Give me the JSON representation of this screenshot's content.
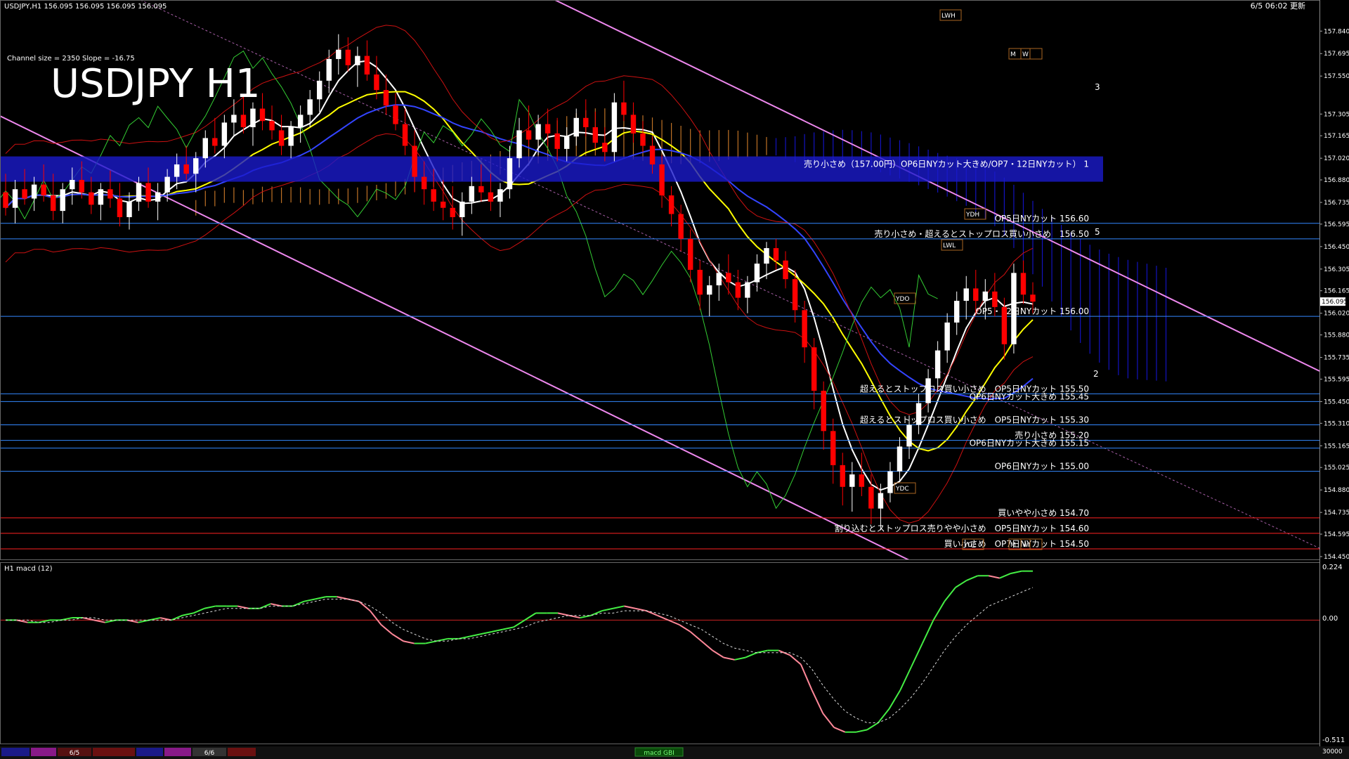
{
  "header": {
    "symbol_info": "USDJPY,H1  156.095 156.095 156.095 156.095",
    "datetime": "6/5 06:02 更新",
    "channel_info": "Channel size = 2350 Slope = -16.75",
    "big_title": "USDJPY H1"
  },
  "macd_panel": {
    "label": "H1  macd (12)",
    "scale_top": "0.224",
    "scale_zero": "0.00",
    "scale_bottom": "-0.511"
  },
  "bottom_bar": {
    "tab_6_5": "6/5",
    "tab_6_6": "6/6",
    "tab_macd": "macd GBI",
    "volume_scale": "30000"
  },
  "colors": {
    "background": "#000000",
    "bull_candle": "#ffffff",
    "bear_candle": "#ff0000",
    "channel_line": "#ee88ee",
    "kumo_blue": "#1a1aff",
    "kumo_orange": "#ff9933",
    "ma_white": "#ffffff",
    "ma_yellow": "#ffff00",
    "ma_blue": "#3344ff",
    "macd_green": "#44ee44",
    "macd_pink": "#ff8899",
    "level_blue": "#3388ff",
    "level_red": "#ff2222"
  },
  "chart_data": {
    "type": "candlestick",
    "price_axis": {
      "ylim": [
        154.45,
        157.95
      ],
      "tick_labels": [
        "157.840",
        "157.695",
        "157.550",
        "157.305",
        "157.165",
        "157.020",
        "156.880",
        "156.735",
        "156.595",
        "156.450",
        "156.305",
        "156.165",
        "156.020",
        "155.880",
        "155.735",
        "155.595",
        "155.450",
        "155.310",
        "155.165",
        "155.025",
        "154.880",
        "154.735",
        "154.595",
        "154.450"
      ],
      "current_price": "156.095"
    },
    "candles": [
      [
        156.8,
        156.92,
        156.65,
        156.7
      ],
      [
        156.7,
        156.88,
        156.6,
        156.82
      ],
      [
        156.82,
        156.95,
        156.72,
        156.76
      ],
      [
        156.76,
        156.9,
        156.68,
        156.85
      ],
      [
        156.85,
        156.98,
        156.74,
        156.78
      ],
      [
        156.78,
        156.92,
        156.62,
        156.68
      ],
      [
        156.68,
        156.86,
        156.6,
        156.82
      ],
      [
        156.82,
        156.96,
        156.72,
        156.88
      ],
      [
        156.88,
        157.0,
        156.76,
        156.8
      ],
      [
        156.8,
        156.9,
        156.66,
        156.72
      ],
      [
        156.72,
        156.86,
        156.62,
        156.82
      ],
      [
        156.82,
        156.94,
        156.7,
        156.76
      ],
      [
        156.76,
        156.86,
        156.58,
        156.64
      ],
      [
        156.64,
        156.8,
        156.56,
        156.74
      ],
      [
        156.74,
        156.9,
        156.68,
        156.86
      ],
      [
        156.86,
        156.96,
        156.7,
        156.74
      ],
      [
        156.74,
        156.86,
        156.62,
        156.8
      ],
      [
        156.8,
        156.95,
        156.74,
        156.9
      ],
      [
        156.9,
        157.05,
        156.82,
        156.98
      ],
      [
        156.98,
        157.1,
        156.88,
        156.92
      ],
      [
        156.92,
        157.06,
        156.8,
        157.02
      ],
      [
        157.02,
        157.2,
        156.96,
        157.15
      ],
      [
        157.15,
        157.28,
        157.05,
        157.1
      ],
      [
        157.1,
        157.3,
        157.02,
        157.25
      ],
      [
        157.25,
        157.4,
        157.16,
        157.3
      ],
      [
        157.3,
        157.42,
        157.18,
        157.22
      ],
      [
        157.22,
        157.38,
        157.1,
        157.34
      ],
      [
        157.34,
        157.44,
        157.2,
        157.26
      ],
      [
        157.26,
        157.36,
        157.14,
        157.2
      ],
      [
        157.2,
        157.3,
        157.04,
        157.1
      ],
      [
        157.1,
        157.26,
        157.02,
        157.22
      ],
      [
        157.22,
        157.36,
        157.12,
        157.3
      ],
      [
        157.3,
        157.46,
        157.22,
        157.4
      ],
      [
        157.4,
        157.58,
        157.32,
        157.52
      ],
      [
        157.52,
        157.72,
        157.44,
        157.66
      ],
      [
        157.66,
        157.82,
        157.56,
        157.72
      ],
      [
        157.72,
        157.8,
        157.58,
        157.62
      ],
      [
        157.62,
        157.74,
        157.48,
        157.68
      ],
      [
        157.68,
        157.78,
        157.52,
        157.56
      ],
      [
        157.56,
        157.68,
        157.4,
        157.46
      ],
      [
        157.46,
        157.56,
        157.3,
        157.36
      ],
      [
        157.36,
        157.44,
        157.2,
        157.24
      ],
      [
        157.24,
        157.34,
        157.04,
        157.1
      ],
      [
        157.1,
        157.2,
        156.8,
        156.9
      ],
      [
        156.9,
        157.0,
        156.72,
        156.82
      ],
      [
        156.82,
        156.95,
        156.68,
        156.74
      ],
      [
        156.74,
        156.88,
        156.62,
        156.7
      ],
      [
        156.7,
        156.84,
        156.56,
        156.64
      ],
      [
        156.64,
        156.8,
        156.52,
        156.74
      ],
      [
        156.74,
        156.9,
        156.66,
        156.84
      ],
      [
        156.84,
        156.98,
        156.74,
        156.8
      ],
      [
        156.8,
        156.92,
        156.68,
        156.74
      ],
      [
        156.74,
        156.86,
        156.64,
        156.82
      ],
      [
        156.82,
        157.1,
        156.76,
        157.02
      ],
      [
        157.02,
        157.28,
        156.96,
        157.2
      ],
      [
        157.2,
        157.36,
        157.1,
        157.14
      ],
      [
        157.14,
        157.3,
        157.04,
        157.24
      ],
      [
        157.24,
        157.34,
        157.1,
        157.18
      ],
      [
        157.18,
        157.28,
        157.0,
        157.08
      ],
      [
        157.08,
        157.22,
        157.0,
        157.16
      ],
      [
        157.16,
        157.34,
        157.1,
        157.28
      ],
      [
        157.28,
        157.4,
        157.16,
        157.22
      ],
      [
        157.22,
        157.32,
        157.08,
        157.12
      ],
      [
        157.12,
        157.22,
        157.0,
        157.06
      ],
      [
        157.06,
        157.44,
        157.0,
        157.38
      ],
      [
        157.38,
        157.52,
        157.26,
        157.3
      ],
      [
        157.3,
        157.38,
        157.12,
        157.18
      ],
      [
        157.18,
        157.26,
        157.06,
        157.1
      ],
      [
        157.1,
        157.16,
        156.92,
        156.98
      ],
      [
        156.98,
        157.04,
        156.7,
        156.78
      ],
      [
        156.78,
        156.84,
        156.58,
        156.66
      ],
      [
        156.66,
        156.72,
        156.42,
        156.5
      ],
      [
        156.5,
        156.56,
        156.22,
        156.3
      ],
      [
        156.3,
        156.36,
        156.04,
        156.14
      ],
      [
        156.14,
        156.26,
        156.0,
        156.2
      ],
      [
        156.2,
        156.34,
        156.1,
        156.28
      ],
      [
        156.28,
        156.4,
        156.14,
        156.22
      ],
      [
        156.22,
        156.3,
        156.04,
        156.12
      ],
      [
        156.12,
        156.26,
        156.02,
        156.22
      ],
      [
        156.22,
        156.4,
        156.16,
        156.34
      ],
      [
        156.34,
        156.48,
        156.24,
        156.44
      ],
      [
        156.44,
        156.5,
        156.3,
        156.36
      ],
      [
        156.36,
        156.42,
        156.18,
        156.24
      ],
      [
        156.24,
        156.3,
        155.96,
        156.04
      ],
      [
        156.04,
        156.1,
        155.7,
        155.8
      ],
      [
        155.8,
        155.86,
        155.4,
        155.52
      ],
      [
        155.52,
        155.58,
        155.14,
        155.26
      ],
      [
        155.26,
        155.34,
        154.92,
        155.04
      ],
      [
        155.04,
        155.12,
        154.78,
        154.9
      ],
      [
        154.9,
        155.06,
        154.74,
        154.98
      ],
      [
        154.98,
        155.12,
        154.84,
        154.9
      ],
      [
        154.9,
        154.98,
        154.66,
        154.76
      ],
      [
        154.76,
        154.92,
        154.62,
        154.86
      ],
      [
        154.86,
        155.06,
        154.8,
        155.0
      ],
      [
        155.0,
        155.22,
        154.94,
        155.16
      ],
      [
        155.16,
        155.36,
        155.08,
        155.3
      ],
      [
        155.3,
        155.5,
        155.24,
        155.44
      ],
      [
        155.44,
        155.66,
        155.38,
        155.6
      ],
      [
        155.6,
        155.84,
        155.52,
        155.78
      ],
      [
        155.78,
        156.02,
        155.7,
        155.96
      ],
      [
        155.96,
        156.16,
        155.88,
        156.1
      ],
      [
        156.1,
        156.26,
        155.98,
        156.18
      ],
      [
        156.18,
        156.3,
        156.02,
        156.1
      ],
      [
        156.1,
        156.24,
        155.98,
        156.16
      ],
      [
        156.16,
        156.28,
        156.0,
        156.06
      ],
      [
        156.06,
        156.12,
        155.72,
        155.82
      ],
      [
        155.82,
        156.34,
        155.76,
        156.28
      ],
      [
        156.28,
        156.36,
        156.08,
        156.14
      ],
      [
        156.14,
        156.22,
        156.02,
        156.095
      ]
    ],
    "levels": [
      {
        "price": 156.95,
        "label": "売り小さめ（157.00円）OP6日NYカット大きめ/OP7・12日NYカット） 1",
        "color": "#3344ff",
        "band": true
      },
      {
        "price": 156.6,
        "label": "OP5日NYカット 156.60",
        "color": "#3388ff"
      },
      {
        "price": 156.5,
        "label": "売り小さめ・超えるとストップロス買い小さめ　156.50",
        "color": "#3388ff"
      },
      {
        "price": 156.0,
        "label": "OP5・12日NYカット 156.00",
        "color": "#3388ff"
      },
      {
        "price": 155.5,
        "label": "超えるとストップロス買い小さめ　OP5日NYカット 155.50",
        "color": "#3388ff"
      },
      {
        "price": 155.45,
        "label": "OP6日NYカット大きめ 155.45",
        "color": "#3388ff"
      },
      {
        "price": 155.3,
        "label": "超えるとストップロス買い小さめ　OP5日NYカット 155.30",
        "color": "#3388ff"
      },
      {
        "price": 155.2,
        "label": "売り小さめ 155.20",
        "color": "#3388ff"
      },
      {
        "price": 155.15,
        "label": "OP6日NYカット大きめ 155.15",
        "color": "#3388ff"
      },
      {
        "price": 155.0,
        "label": "OP6日NYカット 155.00",
        "color": "#3388ff"
      },
      {
        "price": 154.7,
        "label": "買いやや小さめ 154.70",
        "color": "#ff2222"
      },
      {
        "price": 154.6,
        "label": "割り込むとストップロス売りやや小さめ　OP5日NYカット 154.60",
        "color": "#ff2222"
      },
      {
        "price": 154.5,
        "label": "買い小さめ　OP7日NYカット 154.50",
        "color": "#ff2222"
      }
    ],
    "box_labels": [
      "LWH",
      "M",
      "W",
      "YDH",
      "LWL",
      "YDO",
      "YDC",
      "YDL",
      "M",
      "W"
    ],
    "wave_labels": [
      "3",
      "5",
      "2"
    ],
    "macd": {
      "main": [
        0.0,
        0.0,
        -0.01,
        -0.01,
        0.0,
        0.0,
        0.01,
        0.01,
        0.0,
        -0.01,
        0.0,
        0.0,
        -0.01,
        0.0,
        0.01,
        0.0,
        0.02,
        0.03,
        0.05,
        0.06,
        0.06,
        0.06,
        0.05,
        0.05,
        0.07,
        0.06,
        0.06,
        0.08,
        0.09,
        0.1,
        0.1,
        0.09,
        0.08,
        0.04,
        -0.02,
        -0.06,
        -0.09,
        -0.1,
        -0.1,
        -0.09,
        -0.08,
        -0.08,
        -0.07,
        -0.06,
        -0.05,
        -0.04,
        -0.03,
        0.0,
        0.03,
        0.03,
        0.03,
        0.02,
        0.01,
        0.02,
        0.04,
        0.05,
        0.06,
        0.05,
        0.04,
        0.02,
        0.0,
        -0.02,
        -0.05,
        -0.09,
        -0.13,
        -0.16,
        -0.17,
        -0.16,
        -0.14,
        -0.13,
        -0.13,
        -0.15,
        -0.19,
        -0.3,
        -0.4,
        -0.46,
        -0.48,
        -0.48,
        -0.47,
        -0.44,
        -0.38,
        -0.3,
        -0.2,
        -0.1,
        0.0,
        0.08,
        0.14,
        0.17,
        0.19,
        0.19,
        0.18,
        0.2,
        0.21,
        0.21
      ],
      "signal": [
        0.0,
        0.0,
        0.0,
        -0.01,
        -0.01,
        0.0,
        0.0,
        0.01,
        0.01,
        0.0,
        0.0,
        0.0,
        0.0,
        0.0,
        0.0,
        0.0,
        0.01,
        0.02,
        0.03,
        0.04,
        0.05,
        0.05,
        0.05,
        0.05,
        0.06,
        0.06,
        0.06,
        0.07,
        0.08,
        0.09,
        0.09,
        0.09,
        0.08,
        0.06,
        0.03,
        -0.01,
        -0.04,
        -0.06,
        -0.08,
        -0.09,
        -0.09,
        -0.08,
        -0.08,
        -0.07,
        -0.06,
        -0.05,
        -0.04,
        -0.03,
        -0.01,
        0.0,
        0.01,
        0.02,
        0.02,
        0.02,
        0.03,
        0.03,
        0.04,
        0.04,
        0.04,
        0.03,
        0.02,
        0.0,
        -0.02,
        -0.04,
        -0.07,
        -0.1,
        -0.12,
        -0.13,
        -0.14,
        -0.14,
        -0.14,
        -0.14,
        -0.16,
        -0.21,
        -0.28,
        -0.34,
        -0.39,
        -0.42,
        -0.44,
        -0.44,
        -0.42,
        -0.38,
        -0.33,
        -0.27,
        -0.2,
        -0.13,
        -0.07,
        -0.02,
        0.02,
        0.06,
        0.08,
        0.1,
        0.12,
        0.14
      ],
      "ylim": [
        -0.511,
        0.224
      ]
    }
  }
}
